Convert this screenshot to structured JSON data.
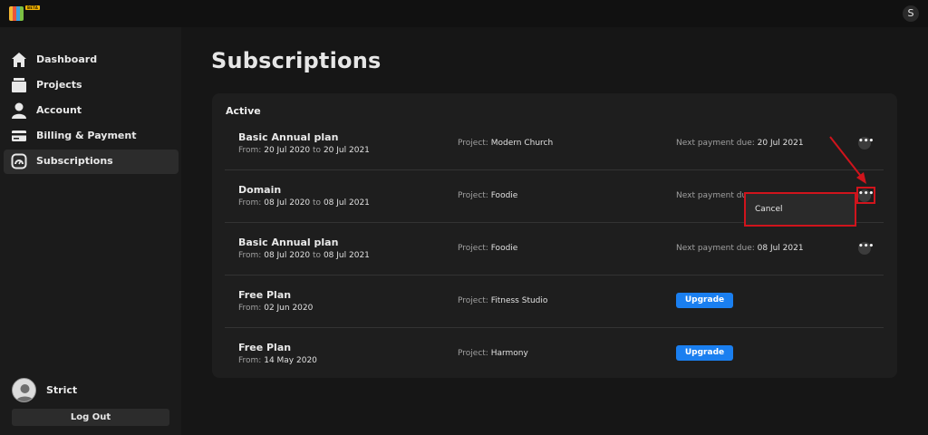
{
  "app": {
    "beta_badge": "BETA",
    "user_initial": "S"
  },
  "sidebar": {
    "items": [
      {
        "label": "Dashboard",
        "icon": "home-icon"
      },
      {
        "label": "Projects",
        "icon": "projects-icon"
      },
      {
        "label": "Account",
        "icon": "account-icon"
      },
      {
        "label": "Billing & Payment",
        "icon": "card-icon"
      },
      {
        "label": "Subscriptions",
        "icon": "subscriptions-icon",
        "active": true
      }
    ],
    "profile_name": "Strict",
    "logout_label": "Log Out"
  },
  "page": {
    "title": "Subscriptions"
  },
  "active_section": {
    "title": "Active",
    "project_label": "Project:",
    "payment_label": "Next payment due:",
    "from_label": "From:",
    "to_label": "to",
    "rows": [
      {
        "name": "Basic Annual plan",
        "from": "20 Jul 2020",
        "to": "20 Jul 2021",
        "project": "Modern Church",
        "next_payment": "20 Jul 2021",
        "more": "•••"
      },
      {
        "name": "Domain",
        "from": "08 Jul 2020",
        "to": "08 Jul 2021",
        "project": "Foodie",
        "next_payment_partial": "Next payment du",
        "more": "•••"
      },
      {
        "name": "Basic Annual plan",
        "from": "08 Jul 2020",
        "to": "08 Jul 2021",
        "project": "Foodie",
        "next_payment": "08 Jul 2021",
        "more": "•••"
      },
      {
        "name": "Free Plan",
        "from": "02 Jun 2020",
        "project": "Fitness Studio",
        "action": "Upgrade"
      },
      {
        "name": "Free Plan",
        "from": "14 May 2020",
        "project": "Harmony",
        "action": "Upgrade"
      }
    ]
  },
  "dropdown": {
    "items": [
      "Cancel"
    ]
  },
  "colors": {
    "accent": "#1a7ff0",
    "annotation": "#d0141c",
    "background": "#161616",
    "card": "#1e1e1e"
  }
}
